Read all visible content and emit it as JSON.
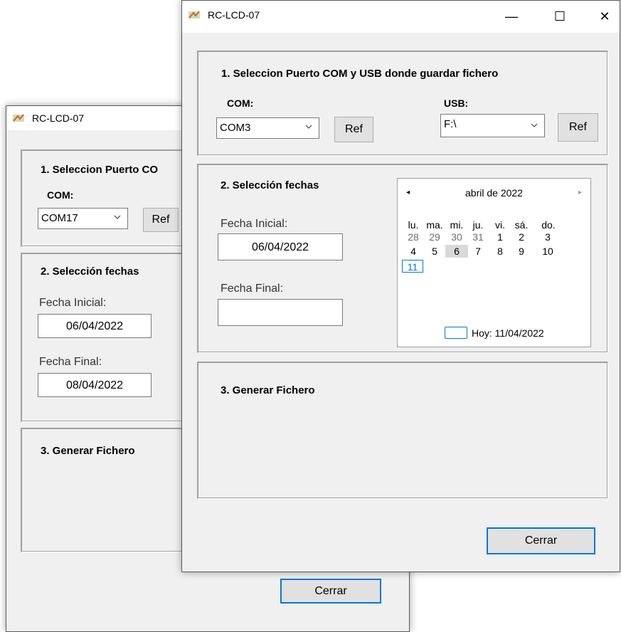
{
  "back_window": {
    "title": "RC-LCD-07",
    "section1_title": "1. Seleccion Puerto CO",
    "com_label": "COM:",
    "com_value": "COM17",
    "ref_label": "Ref",
    "section2_title": "2. Selección fechas",
    "fecha_inicial_label": "Fecha Inicial:",
    "fecha_inicial_value": "06/04/2022",
    "fecha_final_label": "Fecha Final:",
    "fecha_final_value": "08/04/2022",
    "section3_title": "3. Generar Fichero",
    "close_label": "Cerrar"
  },
  "front_window": {
    "title": "RC-LCD-07",
    "minimize_glyph": "—",
    "maximize_glyph": "☐",
    "close_glyph": "✕",
    "section1_title": "1. Seleccion Puerto COM y USB donde guardar fichero",
    "com_label": "COM:",
    "com_value": "COM3",
    "com_ref_label": "Ref",
    "usb_label": "USB:",
    "usb_value": "F:\\",
    "usb_ref_label": "Ref",
    "section2_title": "2. Selección fechas",
    "fecha_inicial_label": "Fecha Inicial:",
    "fecha_inicial_value": "06/04/2022",
    "fecha_final_label": "Fecha Final:",
    "fecha_final_value": "",
    "section3_title": "3. Generar Fichero",
    "close_label": "Cerrar"
  },
  "calendar": {
    "month_title": "abril de 2022",
    "prev_glyph": "◂",
    "next_glyph": "▸",
    "weekdays": [
      "lu.",
      "ma.",
      "mi.",
      "ju.",
      "vi.",
      "sá.",
      "do."
    ],
    "row1": [
      "28",
      "29",
      "30",
      "31",
      "1",
      "2",
      "3"
    ],
    "row2": [
      "4",
      "5",
      "6",
      "7",
      "8",
      "9",
      "10"
    ],
    "row3": [
      "11"
    ],
    "selected_day": "6",
    "today_day": "11",
    "today_label": "Hoy: 11/04/2022"
  },
  "colors": {
    "accent": "#0078d7",
    "window_bg": "#f0f0f0"
  }
}
